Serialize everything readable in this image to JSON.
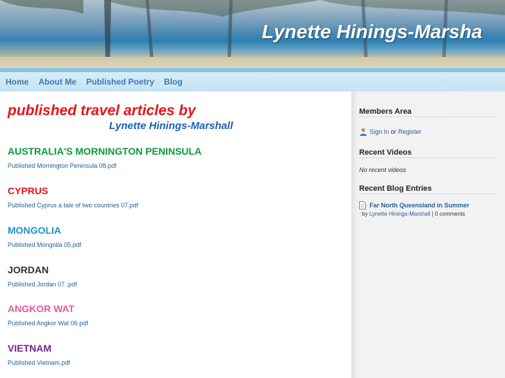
{
  "header": {
    "site_title": "Lynette Hinings-Marsha"
  },
  "nav": {
    "items": [
      "Home",
      "About Me",
      "Published Poetry",
      "Blog"
    ]
  },
  "main": {
    "title_line1": "published travel articles  by",
    "title_line2": "Lynette Hinings-Marshall",
    "articles": [
      {
        "heading": "AUSTRALIA'S MORNINGTON PENINSULA",
        "link": "Published Mornington Peninsula 08.pdf",
        "color": "#0a9a3c"
      },
      {
        "heading": "CYPRUS",
        "link": "Published Cyprus a tale of two countries 07.pdf",
        "color": "#e8141b"
      },
      {
        "heading": "MONGOLIA",
        "link": "Published Mongolia 05.pdf",
        "color": "#1e8fd8"
      },
      {
        "heading": "JORDAN",
        "link": "Published Jordan 07 .pdf",
        "color": "#3a3030"
      },
      {
        "heading": "ANGKOR WAT",
        "link": "Published Angkor Wat 06.pdf",
        "color": "#e85a9c"
      },
      {
        "heading": "VIETNAM",
        "link": "Published Vietnam.pdf",
        "color": "#6a2a8c"
      }
    ]
  },
  "sidebar": {
    "members": {
      "heading": "Members Area",
      "sign_in": "Sign In",
      "or": "or",
      "register": "Register",
      "icon": "user-icon"
    },
    "videos": {
      "heading": "Recent Videos",
      "empty": "No recent videos"
    },
    "blog": {
      "heading": "Recent Blog Entries",
      "entry_title": "Far North Queensland in Summer",
      "by": "by",
      "author": "Lynette Hinings-Marshall",
      "separator": "|",
      "comments": "0 comments",
      "icon": "document-icon"
    }
  }
}
